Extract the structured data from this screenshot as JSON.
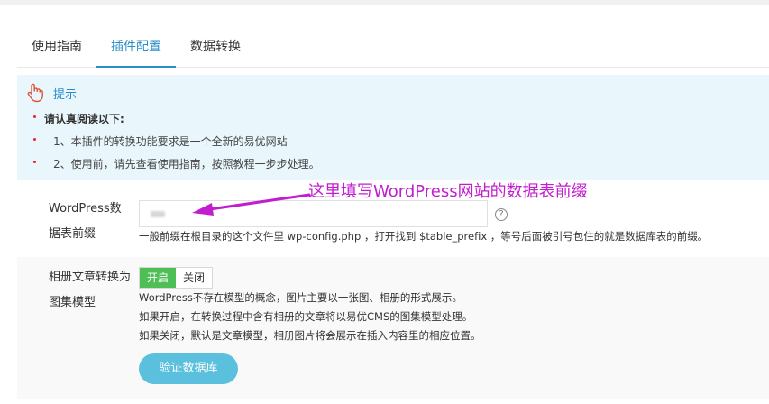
{
  "tabs": [
    {
      "label": "使用指南",
      "active": false
    },
    {
      "label": "插件配置",
      "active": true
    },
    {
      "label": "数据转换",
      "active": false
    }
  ],
  "notice": {
    "icon": "hand-pointer-icon",
    "title": "提示",
    "lines": [
      "请认真阅读以下:",
      "1、本插件的转换功能要求是一个全新的易优网站",
      "2、使用前，请先查看使用指南，按照教程一步步处理。"
    ]
  },
  "form": {
    "prefix": {
      "label_line1": "WordPress数",
      "label_line2": "据表前缀",
      "value": "",
      "hint": "一般前缀在根目录的这个文件里 wp-config.php ，打开找到 $table_prefix ，等号后面被引号包住的就是数据库表的前缀。"
    },
    "album": {
      "label_line1": "相册文章转换为",
      "label_line2": "图集模型",
      "toggle_on": "开启",
      "toggle_off": "关闭",
      "selected": "开启",
      "hint_lines": [
        "WordPress不存在模型的概念，图片主要以一张图、相册的形式展示。",
        "如果开启，在转换过程中含有相册的文章将以易优CMS的图集模型处理。",
        "如果关闭，默认是文章模型，相册图片将会展示在插入内容里的相应位置。"
      ]
    },
    "verify_button": "验证数据库"
  },
  "annotation": {
    "text": "这里填写WordPress网站的数据表前缀",
    "color": "#c21ecf"
  },
  "colors": {
    "accent": "#2a8ec8",
    "notice_bg": "#e9f6fc",
    "toggle_on": "#4ebf57",
    "button": "#5bc0de"
  }
}
